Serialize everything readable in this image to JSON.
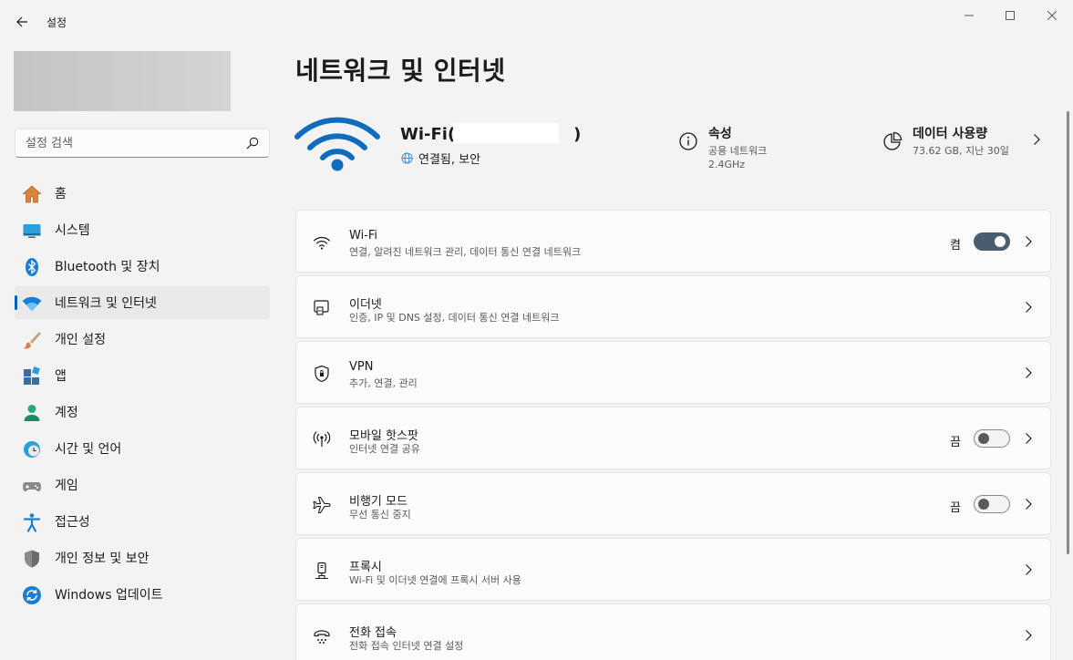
{
  "window": {
    "title": "설정"
  },
  "sidebar": {
    "search_placeholder": "설정 검색",
    "items": [
      {
        "label": "홈",
        "icon": "home-icon"
      },
      {
        "label": "시스템",
        "icon": "system-icon"
      },
      {
        "label": "Bluetooth 및 장치",
        "icon": "bluetooth-icon"
      },
      {
        "label": "네트워크 및 인터넷",
        "icon": "network-icon",
        "active": true
      },
      {
        "label": "개인 설정",
        "icon": "brush-icon"
      },
      {
        "label": "앱",
        "icon": "apps-icon"
      },
      {
        "label": "계정",
        "icon": "account-icon"
      },
      {
        "label": "시간 및 언어",
        "icon": "time-language-icon"
      },
      {
        "label": "게임",
        "icon": "gaming-icon"
      },
      {
        "label": "접근성",
        "icon": "accessibility-icon"
      },
      {
        "label": "개인 정보 및 보안",
        "icon": "shield-icon"
      },
      {
        "label": "Windows 업데이트",
        "icon": "update-icon"
      }
    ]
  },
  "main": {
    "page_title": "네트워크 및 인터넷",
    "hero": {
      "network_name": "Wi-Fi(K",
      "network_name_end": ")",
      "status": "연결됨, 보안"
    },
    "properties": {
      "title": "속성",
      "line1": "공용 네트워크",
      "line2": "2.4GHz"
    },
    "data_usage": {
      "title": "데이터 사용량",
      "detail": "73.62 GB, 지난 30일"
    },
    "cards": [
      {
        "title": "Wi-Fi",
        "desc": "연결, 알려진 네트워크 관리, 데이터 통신 연결 네트워크",
        "icon": "wifi-icon",
        "toggle": {
          "label": "켬",
          "on": true
        }
      },
      {
        "title": "이더넷",
        "desc": "인증, IP 및 DNS 설정, 데이터 통신 연결 네트워크",
        "icon": "ethernet-icon"
      },
      {
        "title": "VPN",
        "desc": "추가, 연결, 관리",
        "icon": "vpn-shield-icon"
      },
      {
        "title": "모바일 핫스팟",
        "desc": "인터넷 연결 공유",
        "icon": "hotspot-icon",
        "toggle": {
          "label": "끔",
          "on": false
        }
      },
      {
        "title": "비행기 모드",
        "desc": "무선 통신 중지",
        "icon": "airplane-icon",
        "toggle": {
          "label": "끔",
          "on": false
        }
      },
      {
        "title": "프록시",
        "desc": "Wi-Fi 및 이더넷 연결에 프록시 서버 사용",
        "icon": "proxy-icon"
      },
      {
        "title": "전화 접속",
        "desc": "전화 접속 인터넷 연결 설정",
        "icon": "dialup-icon"
      }
    ]
  },
  "colors": {
    "accent": "#005fb8",
    "wifi_blue": "#0f6cbd",
    "toggle_on": "#4a5d6e"
  }
}
